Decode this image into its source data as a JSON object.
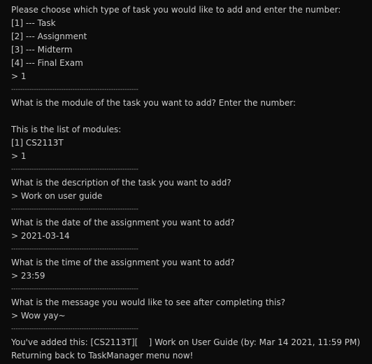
{
  "terminal": {
    "lines": [
      {
        "text": "Please choose which type of task you would like to add and enter the number:",
        "kind": "output"
      },
      {
        "text": "[1] --- Task",
        "kind": "output"
      },
      {
        "text": "[2] --- Assignment",
        "kind": "output"
      },
      {
        "text": "[3] --- Midterm",
        "kind": "output"
      },
      {
        "text": "[4] --- Final Exam",
        "kind": "output"
      },
      {
        "text": "> 1",
        "kind": "input"
      },
      {
        "text": "--------------------------------------------------------",
        "kind": "separator"
      },
      {
        "text": "What is the module of the task you want to add? Enter the number:",
        "kind": "output"
      },
      {
        "text": "",
        "kind": "blank"
      },
      {
        "text": "This is the list of modules:",
        "kind": "output"
      },
      {
        "text": "[1] CS2113T",
        "kind": "output"
      },
      {
        "text": "> 1",
        "kind": "input"
      },
      {
        "text": "--------------------------------------------------------",
        "kind": "separator"
      },
      {
        "text": "What is the description of the task you want to add?",
        "kind": "output"
      },
      {
        "text": "> Work on user guide",
        "kind": "input"
      },
      {
        "text": "--------------------------------------------------------",
        "kind": "separator"
      },
      {
        "text": "What is the date of the assignment you want to add?",
        "kind": "output"
      },
      {
        "text": "> 2021-03-14",
        "kind": "input"
      },
      {
        "text": "--------------------------------------------------------",
        "kind": "separator"
      },
      {
        "text": "What is the time of the assignment you want to add?",
        "kind": "output"
      },
      {
        "text": "> 23:59",
        "kind": "input"
      },
      {
        "text": "--------------------------------------------------------",
        "kind": "separator"
      },
      {
        "text": "What is the message you would like to see after completing this?",
        "kind": "output"
      },
      {
        "text": "> Wow yay~",
        "kind": "input"
      },
      {
        "text": "--------------------------------------------------------",
        "kind": "separator"
      },
      {
        "text": "You've added this: [CS2113T][    ] Work on User Guide (by: Mar 14 2021, 11:59 PM)",
        "kind": "output"
      },
      {
        "text": "Returning back to TaskManager menu now!",
        "kind": "output"
      }
    ]
  },
  "colors": {
    "background": "#0c0c0c",
    "text": "#cccccc",
    "separator": "#9a9a9a"
  }
}
